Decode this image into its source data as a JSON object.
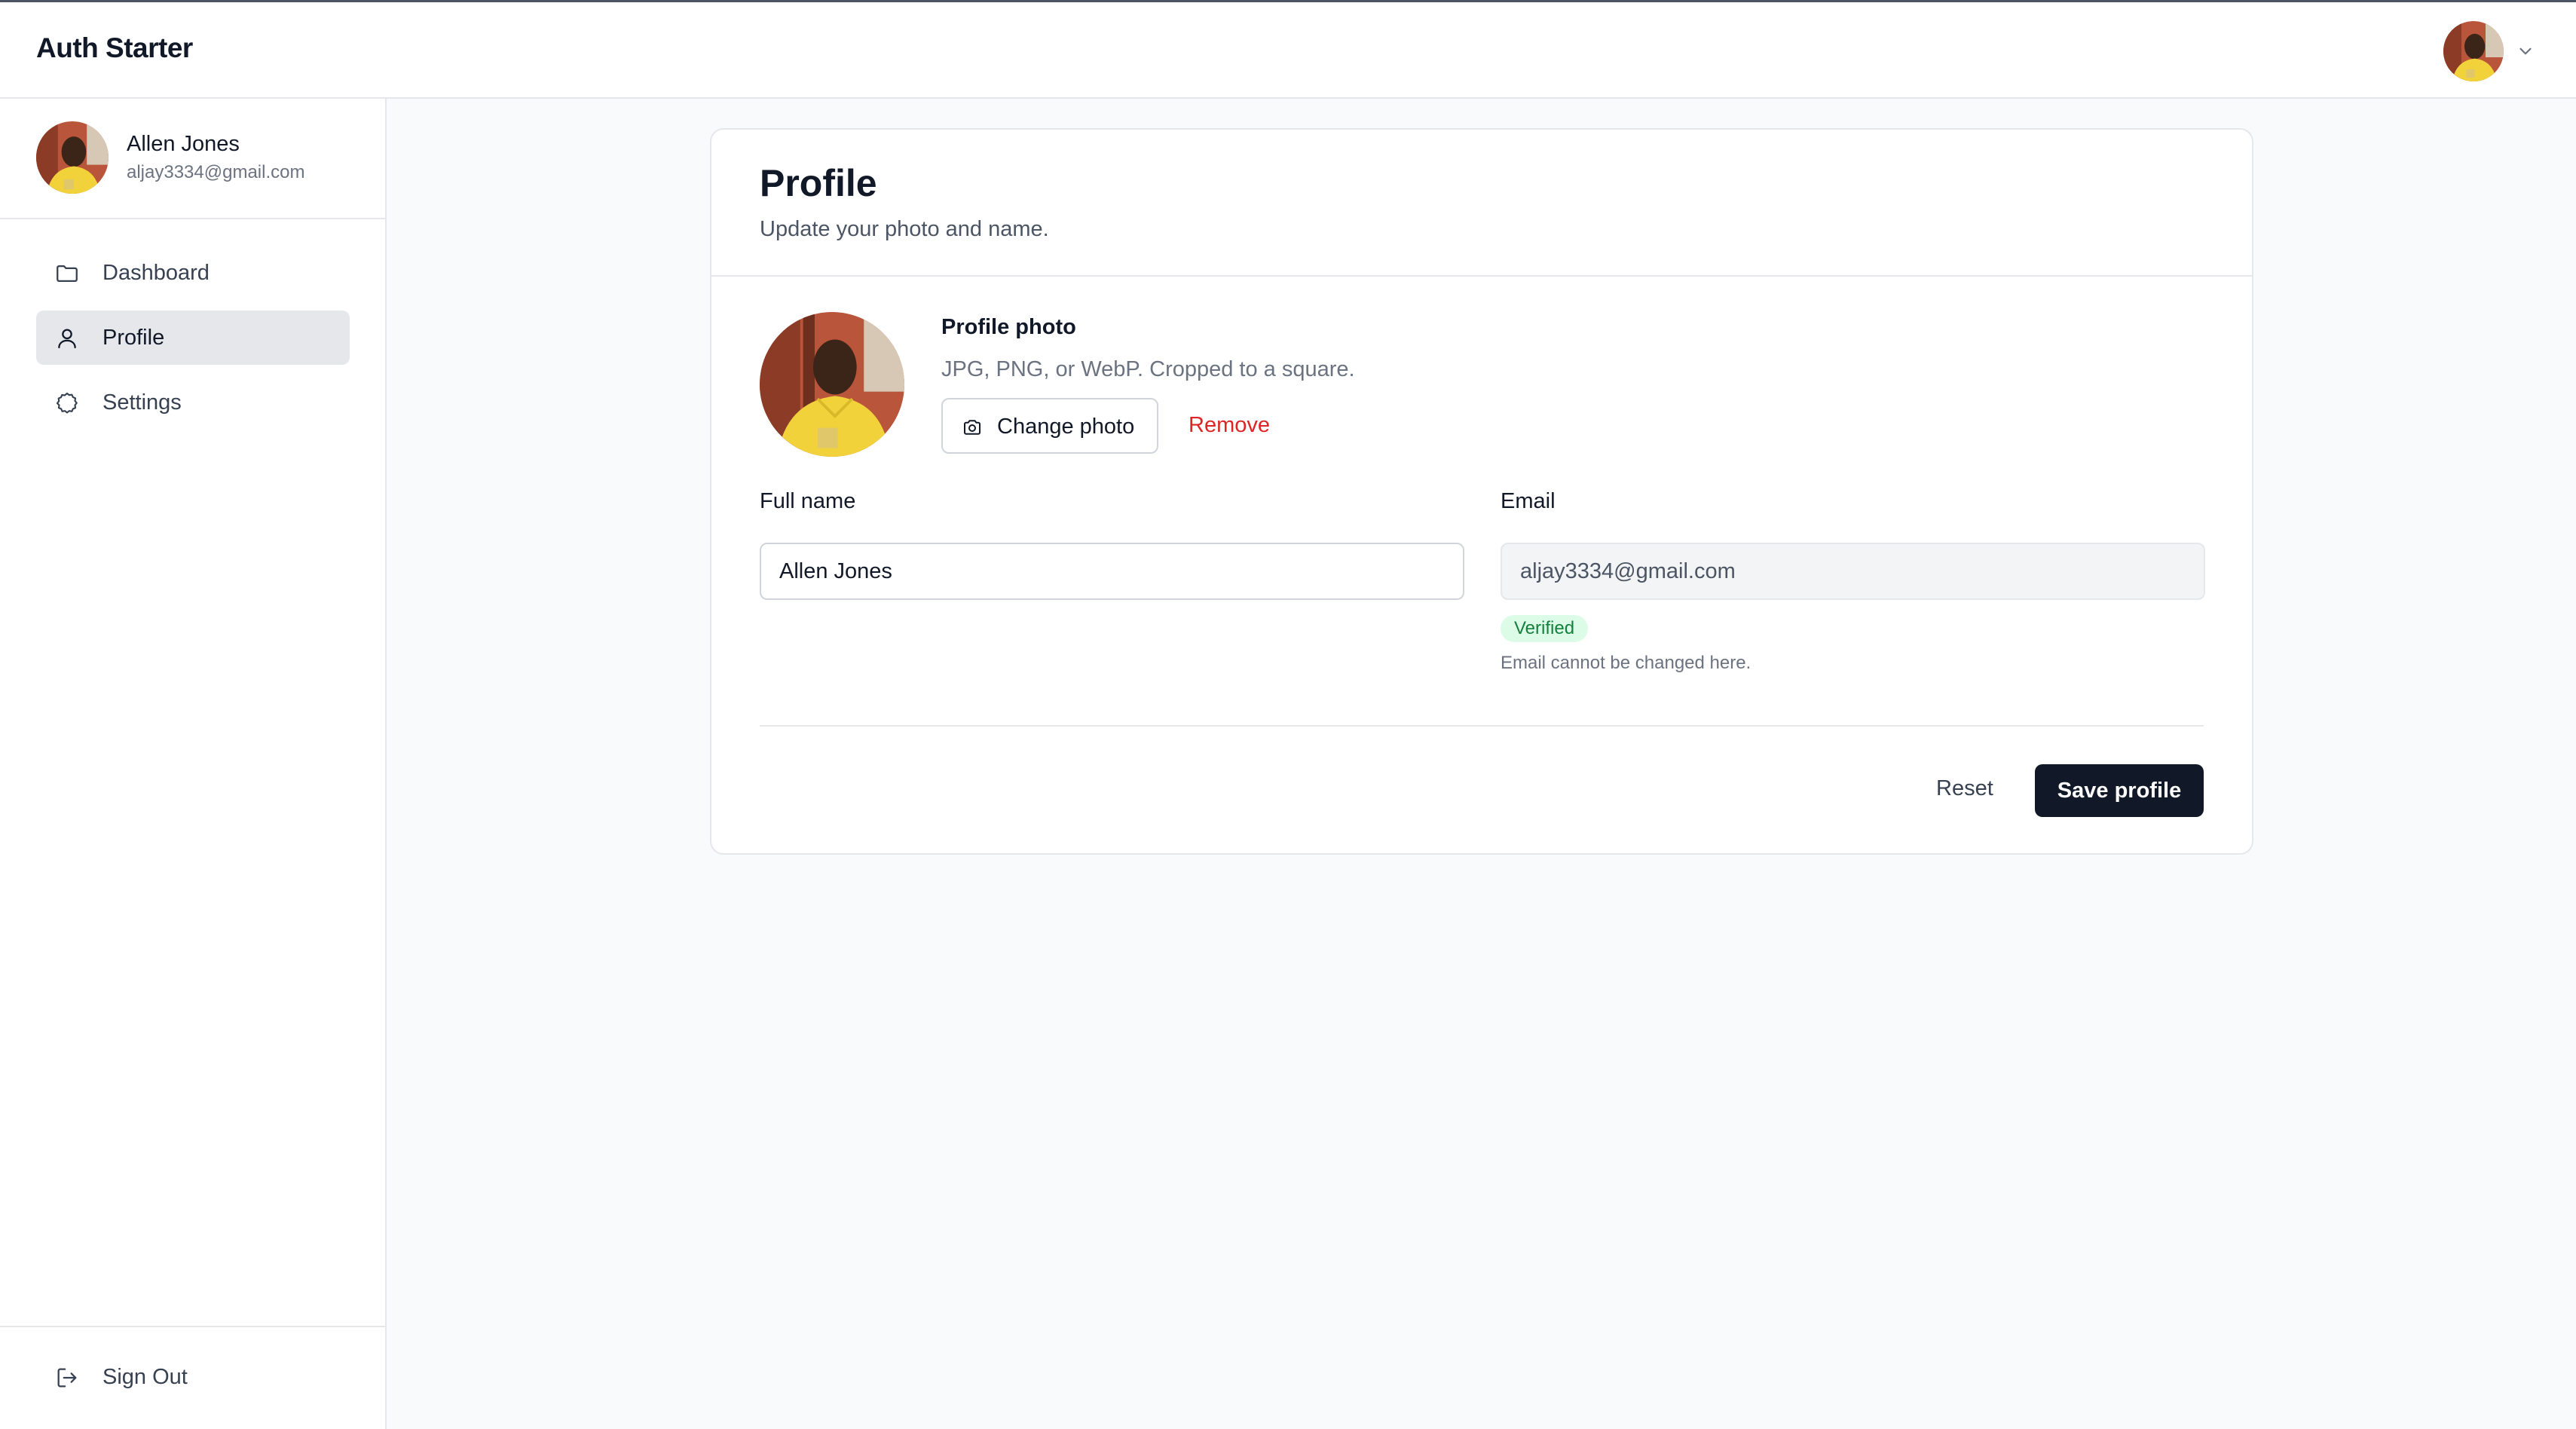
{
  "app": {
    "title": "Auth Starter"
  },
  "user": {
    "name": "Allen Jones",
    "email": "aljay3334@gmail.com"
  },
  "sidebar": {
    "items": [
      {
        "label": "Dashboard",
        "icon": "folder-icon",
        "active": false
      },
      {
        "label": "Profile",
        "icon": "user-icon",
        "active": true
      },
      {
        "label": "Settings",
        "icon": "gear-icon",
        "active": false
      }
    ],
    "sign_out": {
      "label": "Sign Out",
      "icon": "sign-out-icon"
    }
  },
  "profile": {
    "title": "Profile",
    "subtitle": "Update your photo and name.",
    "photo_title": "Profile photo",
    "photo_hint": "JPG, PNG, or WebP. Cropped to a square.",
    "change_photo_label": "Change photo",
    "remove_label": "Remove",
    "full_name_label": "Full name",
    "full_name_value": "Allen Jones",
    "email_label": "Email",
    "email_value": "aljay3334@gmail.com",
    "verified_badge": "Verified",
    "email_note": "Email cannot be changed here.",
    "reset_label": "Reset",
    "save_label": "Save profile"
  },
  "colors": {
    "accent_dark": "#111827",
    "danger": "#dc2626",
    "verified_bg": "#dcfce7",
    "verified_text": "#15803d",
    "active_nav": "#e5e7eb"
  }
}
